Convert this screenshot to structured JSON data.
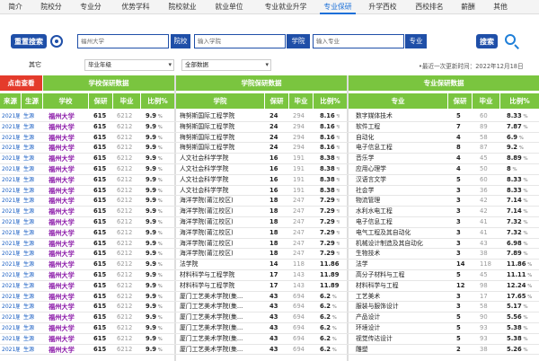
{
  "nav": {
    "tabs": [
      "简介",
      "院校分",
      "专业分",
      "优势学科",
      "院校就业",
      "就业单位",
      "专业就业升学",
      "专业保研",
      "升学西校",
      "西校排名",
      "薪酬",
      "其他"
    ],
    "active_index": 7
  },
  "search": {
    "logo_label": "重置搜索",
    "school_value": "福州大学",
    "school_button": "院校",
    "college_placeholder": "输入学院",
    "college_button": "学院",
    "major_placeholder": "输入专业",
    "major_button": "专业",
    "search_button": "搜索"
  },
  "filters": {
    "label": "其它",
    "year_value": "毕业年级",
    "data_value": "全部数据",
    "updated_text": "•最近一次更新时间：2022年12月18日"
  },
  "header1": {
    "click_view": "点击查看",
    "school_group": "学校保研数据",
    "college_group": "学院保研数据",
    "major_group": "专业保研数据",
    "watermark": "www.sxygaokao.cn"
  },
  "header2": {
    "source": "来源",
    "origin": "生源",
    "school": "学校",
    "baoyan": "保研",
    "grads": "毕业",
    "ratio": "比例%",
    "college": "学院",
    "college_baoyan": "保研",
    "college_grads": "毕业",
    "college_ratio": "比例%",
    "major": "专业",
    "major_baoyan": "保研",
    "major_grads": "毕业",
    "major_ratio": "比例%"
  },
  "rows": [
    {
      "year": "2021届",
      "src": "生源",
      "school": "福州大学",
      "sb": "615",
      "sg": "6212",
      "sr": "9.9",
      "college": "梅努斯国际工程学院",
      "cb": "24",
      "cg": "294",
      "cr": "8.16",
      "major": "数字媒体技术",
      "mb": "5",
      "mg": "60",
      "mr": "8.33"
    },
    {
      "year": "2021届",
      "src": "生源",
      "school": "福州大学",
      "sb": "615",
      "sg": "6212",
      "sr": "9.9",
      "college": "梅努斯国际工程学院",
      "cb": "24",
      "cg": "294",
      "cr": "8.16",
      "major": "软件工程",
      "mb": "7",
      "mg": "89",
      "mr": "7.87"
    },
    {
      "year": "2021届",
      "src": "生源",
      "school": "福州大学",
      "sb": "615",
      "sg": "6212",
      "sr": "9.9",
      "college": "梅努斯国际工程学院",
      "cb": "24",
      "cg": "294",
      "cr": "8.16",
      "major": "自动化",
      "mb": "4",
      "mg": "58",
      "mr": "6.9"
    },
    {
      "year": "2021届",
      "src": "生源",
      "school": "福州大学",
      "sb": "615",
      "sg": "6212",
      "sr": "9.9",
      "college": "梅努斯国际工程学院",
      "cb": "24",
      "cg": "294",
      "cr": "8.16",
      "major": "电子信息工程",
      "mb": "8",
      "mg": "87",
      "mr": "9.2"
    },
    {
      "year": "2021届",
      "src": "生源",
      "school": "福州大学",
      "sb": "615",
      "sg": "6212",
      "sr": "9.9",
      "college": "人文社会科学学院",
      "cb": "16",
      "cg": "191",
      "cr": "8.38",
      "major": "音乐学",
      "mb": "4",
      "mg": "45",
      "mr": "8.89"
    },
    {
      "year": "2021届",
      "src": "生源",
      "school": "福州大学",
      "sb": "615",
      "sg": "6212",
      "sr": "9.9",
      "college": "人文社会科学学院",
      "cb": "16",
      "cg": "191",
      "cr": "8.38",
      "major": "应用心理学",
      "mb": "4",
      "mg": "50",
      "mr": "8"
    },
    {
      "year": "2021届",
      "src": "生源",
      "school": "福州大学",
      "sb": "615",
      "sg": "6212",
      "sr": "9.9",
      "college": "人文社会科学学院",
      "cb": "16",
      "cg": "191",
      "cr": "8.38",
      "major": "汉语言文学",
      "mb": "5",
      "mg": "60",
      "mr": "8.33"
    },
    {
      "year": "2021届",
      "src": "生源",
      "school": "福州大学",
      "sb": "615",
      "sg": "6212",
      "sr": "9.9",
      "college": "人文社会科学学院",
      "cb": "16",
      "cg": "191",
      "cr": "8.38",
      "major": "社会学",
      "mb": "3",
      "mg": "36",
      "mr": "8.33"
    },
    {
      "year": "2021届",
      "src": "生源",
      "school": "福州大学",
      "sb": "615",
      "sg": "6212",
      "sr": "9.9",
      "college": "海洋学院(莆江校区)",
      "cb": "18",
      "cg": "247",
      "cr": "7.29",
      "major": "物流管理",
      "mb": "3",
      "mg": "42",
      "mr": "7.14"
    },
    {
      "year": "2021届",
      "src": "生源",
      "school": "福州大学",
      "sb": "615",
      "sg": "6212",
      "sr": "9.9",
      "college": "海洋学院(莆江校区)",
      "cb": "18",
      "cg": "247",
      "cr": "7.29",
      "major": "水利水电工程",
      "mb": "3",
      "mg": "42",
      "mr": "7.14"
    },
    {
      "year": "2021届",
      "src": "生源",
      "school": "福州大学",
      "sb": "615",
      "sg": "6212",
      "sr": "9.9",
      "college": "海洋学院(莆江校区)",
      "cb": "18",
      "cg": "247",
      "cr": "7.29",
      "major": "电子信息工程",
      "mb": "3",
      "mg": "41",
      "mr": "7.32"
    },
    {
      "year": "2021届",
      "src": "生源",
      "school": "福州大学",
      "sb": "615",
      "sg": "6212",
      "sr": "9.9",
      "college": "海洋学院(莆江校区)",
      "cb": "18",
      "cg": "247",
      "cr": "7.29",
      "major": "电气工程及其自动化",
      "mb": "3",
      "mg": "41",
      "mr": "7.32"
    },
    {
      "year": "2021届",
      "src": "生源",
      "school": "福州大学",
      "sb": "615",
      "sg": "6212",
      "sr": "9.9",
      "college": "海洋学院(莆江校区)",
      "cb": "18",
      "cg": "247",
      "cr": "7.29",
      "major": "机械设计制造及其自动化",
      "mb": "3",
      "mg": "43",
      "mr": "6.98"
    },
    {
      "year": "2021届",
      "src": "生源",
      "school": "福州大学",
      "sb": "615",
      "sg": "6212",
      "sr": "9.9",
      "college": "海洋学院(莆江校区)",
      "cb": "18",
      "cg": "247",
      "cr": "7.29",
      "major": "生物技术",
      "mb": "3",
      "mg": "38",
      "mr": "7.89"
    },
    {
      "year": "2021届",
      "src": "生源",
      "school": "福州大学",
      "sb": "615",
      "sg": "6212",
      "sr": "9.9",
      "college": "法学院",
      "cb": "14",
      "cg": "118",
      "cr": "11.86",
      "major": "法学",
      "mb": "14",
      "mg": "118",
      "mr": "11.86"
    },
    {
      "year": "2021届",
      "src": "生源",
      "school": "福州大学",
      "sb": "615",
      "sg": "6212",
      "sr": "9.9",
      "college": "材料科学与工程学院",
      "cb": "17",
      "cg": "143",
      "cr": "11.89",
      "major": "高分子材料与工程",
      "mb": "5",
      "mg": "45",
      "mr": "11.11"
    },
    {
      "year": "2021届",
      "src": "生源",
      "school": "福州大学",
      "sb": "615",
      "sg": "6212",
      "sr": "9.9",
      "college": "材料科学与工程学院",
      "cb": "17",
      "cg": "143",
      "cr": "11.89",
      "major": "材料科学与工程",
      "mb": "12",
      "mg": "98",
      "mr": "12.24"
    },
    {
      "year": "2021届",
      "src": "生源",
      "school": "福州大学",
      "sb": "615",
      "sg": "6212",
      "sr": "9.9",
      "college": "厦门工艺美术学院(集...",
      "cb": "43",
      "cg": "694",
      "cr": "6.2",
      "major": "工艺美术",
      "mb": "3",
      "mg": "17",
      "mr": "17.65"
    },
    {
      "year": "2021届",
      "src": "生源",
      "school": "福州大学",
      "sb": "615",
      "sg": "6212",
      "sr": "9.9",
      "college": "厦门工艺美术学院(集...",
      "cb": "43",
      "cg": "694",
      "cr": "6.2",
      "major": "服装与服饰设计",
      "mb": "3",
      "mg": "58",
      "mr": "5.17"
    },
    {
      "year": "2021届",
      "src": "生源",
      "school": "福州大学",
      "sb": "615",
      "sg": "6212",
      "sr": "9.9",
      "college": "厦门工艺美术学院(集...",
      "cb": "43",
      "cg": "694",
      "cr": "6.2",
      "major": "产品设计",
      "mb": "5",
      "mg": "90",
      "mr": "5.56"
    },
    {
      "year": "2021届",
      "src": "生源",
      "school": "福州大学",
      "sb": "615",
      "sg": "6212",
      "sr": "9.9",
      "college": "厦门工艺美术学院(集...",
      "cb": "43",
      "cg": "694",
      "cr": "6.2",
      "major": "环境设计",
      "mb": "5",
      "mg": "93",
      "mr": "5.38"
    },
    {
      "year": "2021届",
      "src": "生源",
      "school": "福州大学",
      "sb": "615",
      "sg": "6212",
      "sr": "9.9",
      "college": "厦门工艺美术学院(集...",
      "cb": "43",
      "cg": "694",
      "cr": "6.2",
      "major": "视觉传达设计",
      "mb": "5",
      "mg": "93",
      "mr": "5.38"
    },
    {
      "year": "2021届",
      "src": "生源",
      "school": "福州大学",
      "sb": "615",
      "sg": "6212",
      "sr": "9.9",
      "college": "厦门工艺美术学院(集...",
      "cb": "43",
      "cg": "694",
      "cr": "6.2",
      "major": "雕塑",
      "mb": "2",
      "mg": "38",
      "mr": "5.26"
    }
  ]
}
